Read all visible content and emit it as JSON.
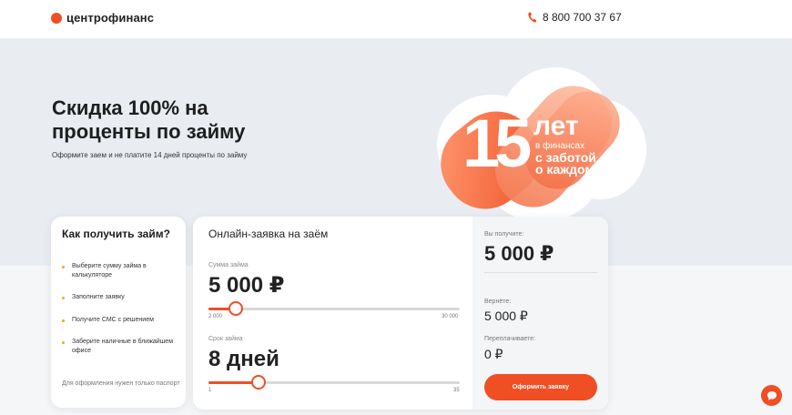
{
  "header": {
    "logo_text": "центрофинанс",
    "phone": "8 800 700 37 67"
  },
  "hero": {
    "title": "Скидка 100% на проценты по займу",
    "subtitle": "Оформите заем и не платите 14 дней проценты по займу"
  },
  "promo": {
    "number": "15",
    "years": "лет",
    "line1": "в финансах",
    "line2": "с заботой",
    "line3": "о каждом"
  },
  "how_to": {
    "title": "Как получить займ?",
    "steps": [
      "Выберите сумму займа в калькуляторе",
      "Заполните заявку",
      "Получите СМС с решением",
      "Заберите наличные в ближайшем офисе"
    ],
    "note": "Для оформления нужен только паспорт"
  },
  "form": {
    "title": "Онлайн-заявка на заём",
    "amount": {
      "label": "Сумма займа",
      "value": "5 000 ₽",
      "min": "2 000",
      "max": "30 000",
      "fraction": 0.107
    },
    "term": {
      "label": "Срок займа",
      "value": "8  дней",
      "min": "1",
      "max": "35",
      "fraction": 0.2
    }
  },
  "summary": {
    "receive_label": "Вы получите:",
    "receive_value": "5 000 ₽",
    "return_label": "Вернёте:",
    "return_value": "5 000 ₽",
    "overpay_label": "Переплачиваете:",
    "overpay_value": "0 ₽",
    "button": "Оформить заявку"
  },
  "colors": {
    "accent": "#f04e23",
    "step_dot": "#f7a21b",
    "hero_bg": "#e9edf2"
  },
  "icons": {
    "phone": "phone-icon",
    "chat": "chat-icon"
  }
}
